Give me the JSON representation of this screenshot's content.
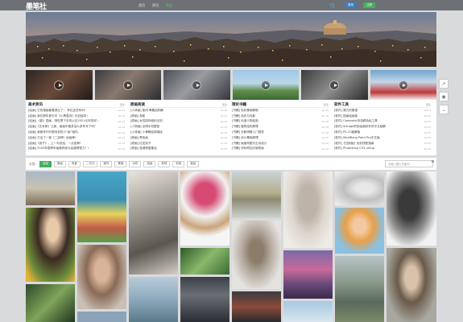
{
  "header": {
    "logo_text": "墨笔社",
    "nav": [
      "首页",
      "资讯",
      "作品"
    ],
    "login_label": "登录",
    "register_label": "注册"
  },
  "news": {
    "more_label": "更多",
    "columns": [
      {
        "title": "美术资讯",
        "items": [
          {
            "text": "[绘画] 它的插画都要哭泣了！ 有位这些系列!",
            "date": "10-14"
          },
          {
            "text": "[绘画] 我在那年夏天中《小黑童诗》仍旧保持！",
            "date": "10-14"
          },
          {
            "text": "[绘画] 《影》插画，神在是下手的以无2021元年的好…",
            "date": "10-14"
          },
          {
            "text": "[绘画]《艺术家》之美，画画中做多这么多年写了吗？",
            "date": "10-14"
          },
          {
            "text": "[绘画] 我都年刊刊载何初的少“画”错内。",
            "date": "10-14"
          },
          {
            "text": "[绘画] 又出了一部《二战神》绘画神!",
            "date": "10-14"
          },
          {
            "text": "[绘画]《游子》，上一句总结，一点如神!",
            "date": "10-14"
          },
          {
            "text": "[绘画] 2020年国青年画展获奖大会围得很刀！!",
            "date": "10-14"
          }
        ]
      },
      {
        "title": "原画阅读",
        "items": [
          {
            "text": "[人体画] 肌肉·骨骼结构解",
            "date": "10-18"
          },
          {
            "text": "[原画] 背影",
            "date": "10-18"
          },
          {
            "text": "[原画] 女性肌肉组织法范",
            "date": "10-18"
          },
          {
            "text": "[人物画] 全明手机壁纸",
            "date": "10-18"
          },
          {
            "text": "[人体画] 小骨骼绘制描绘",
            "date": "10-18"
          },
          {
            "text": "[原画] 黑色画",
            "date": "10-18"
          },
          {
            "text": "[原画] 红发双子",
            "date": "10-18"
          },
          {
            "text": "[原画] 强调修复集结",
            "date": "10-18"
          }
        ]
      },
      {
        "title": "理论书籍",
        "items": [
          {
            "text": "[书籍] 色彩基础教程",
            "date": "10-18"
          },
          {
            "text": "[书籍] 色彩与光影",
            "date": "10-18"
          },
          {
            "text": "[书籍] 动漫人物绘制",
            "date": "10-18"
          },
          {
            "text": "[书籍] 建筑结构原理",
            "date": "10-18"
          },
          {
            "text": "[书籍] 光影明暗入门指导",
            "date": "10-18"
          },
          {
            "text": "[书籍] 设计基础原理",
            "date": "10-18"
          },
          {
            "text": "[书籍] 画面构图与生动设计",
            "date": "10-18"
          },
          {
            "text": "[书籍] 材料附加分钢笔画",
            "date": "10-18"
          }
        ]
      },
      {
        "title": "软件工具",
        "items": [
          {
            "text": "[软件] 魔方的素描",
            "date": "10-03"
          },
          {
            "text": "[软件] 插画绘画板",
            "date": "10-03"
          },
          {
            "text": "[软件] Corepaint浮游颜色绘工具",
            "date": "10-03"
          },
          {
            "text": "[软件] artrage的用绘画软件的中文破解",
            "date": "10-03"
          },
          {
            "text": "[软件] PS-CS破解版",
            "date": "10-03"
          },
          {
            "text": "[软件] MediBang Paint Pro中文版",
            "date": "10-03"
          },
          {
            "text": "[软件]【扫描版】色彩搭配指南",
            "date": "10-03"
          },
          {
            "text": "[软件] Photoshop CS3_setup",
            "date": "10-03"
          }
        ]
      }
    ]
  },
  "filter": {
    "label": "分类:",
    "chips": [
      "全部",
      "原画",
      "风景",
      "二次元",
      "速写",
      "素描",
      "水彩",
      "油画",
      "其他",
      "彩铅",
      "板绘"
    ],
    "active_index": 0,
    "search_placeholder": "请输入图片关键词..."
  },
  "side_tools": [
    "share-icon",
    "wechat-icon",
    "chevron-down-icon"
  ]
}
